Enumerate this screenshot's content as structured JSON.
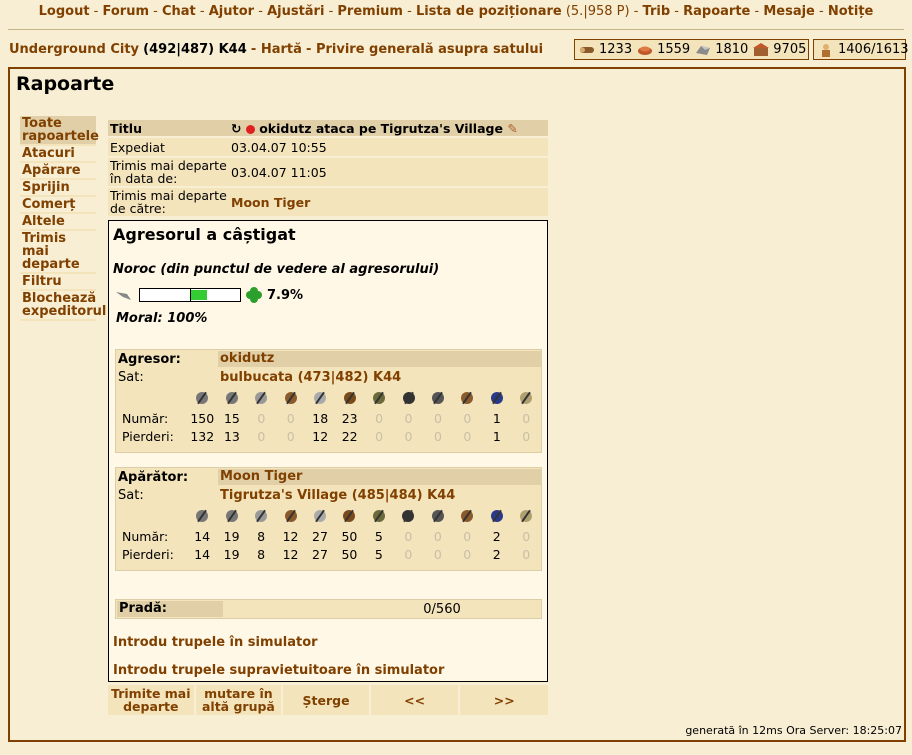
{
  "topmenu": {
    "items": [
      "Logout",
      "Forum",
      "Chat",
      "Ajutor",
      "Ajustări",
      "Premium",
      "Lista de poziționare",
      "Trib",
      "Rapoarte",
      "Mesaje",
      "Notițe"
    ],
    "ranking_info": "(5.|958 P)"
  },
  "village": {
    "name": "Underground City",
    "coords": "(492|487) K44",
    "map_link": "Hartă",
    "overview_link": "Privire generală asupra satului"
  },
  "resources": {
    "wood": "1233",
    "clay": "1559",
    "iron": "1810",
    "storage": "9705",
    "population": "1406/1613"
  },
  "page_title": "Rapoarte",
  "sidemenu": [
    "Toate rapoartele",
    "Atacuri",
    "Apărare",
    "Sprijin",
    "Comerț",
    "Altele",
    "Trimis mai departe",
    "Filtru",
    "Blochează expeditorul"
  ],
  "report": {
    "title_label": "Titlu",
    "title": "okidutz ataca pe Tigrutza's Village",
    "sent_label": "Expediat",
    "sent": "03.04.07 10:55",
    "fwd_date_label": "Trimis mai departe în data de:",
    "fwd_date": "03.04.07 11:05",
    "fwd_by_label": "Trimis mai departe de către:",
    "fwd_by": "Moon Tiger",
    "result": "Agresorul a câștigat",
    "luck_label": "Noroc (din punctul de vedere al agresorului)",
    "luck_value": "7.9%",
    "luck_fraction": 0.079,
    "morale": "Moral: 100%",
    "attacker": {
      "label": "Agresor:",
      "player": "okidutz",
      "village_label": "Sat:",
      "village": "bulbucata (473|482) K44",
      "count_label": "Număr:",
      "loss_label": "Pierderi:",
      "counts": [
        "150",
        "15",
        "0",
        "0",
        "18",
        "23",
        "0",
        "0",
        "0",
        "0",
        "1",
        "0"
      ],
      "losses": [
        "132",
        "13",
        "0",
        "0",
        "12",
        "22",
        "0",
        "0",
        "0",
        "0",
        "1",
        "0"
      ]
    },
    "defender": {
      "label": "Apărător:",
      "player": "Moon Tiger",
      "village_label": "Sat:",
      "village": "Tigrutza's Village (485|484) K44",
      "count_label": "Număr:",
      "loss_label": "Pierderi:",
      "counts": [
        "14",
        "19",
        "8",
        "12",
        "27",
        "50",
        "5",
        "0",
        "0",
        "0",
        "2",
        "0"
      ],
      "losses": [
        "14",
        "19",
        "8",
        "12",
        "27",
        "50",
        "5",
        "0",
        "0",
        "0",
        "2",
        "0"
      ]
    },
    "unit_icons": [
      "spear-icon",
      "sword-icon",
      "axe-icon",
      "archer-icon",
      "scout-icon",
      "light-cavalry-icon",
      "mounted-archer-icon",
      "heavy-cavalry-icon",
      "ram-icon",
      "catapult-icon",
      "paladin-icon",
      "noble-icon"
    ],
    "loot_label": "Pradă:",
    "loot": "0/560",
    "sim_link": "Introdu trupele în simulator",
    "sim_survivors_link": "Introdu trupele supravietuitoare în simulator"
  },
  "actions": {
    "forward": "Trimite mai departe",
    "move": "mutare în altă grupă",
    "delete": "Șterge",
    "prev": "<<",
    "next": ">>"
  },
  "footer": "generată în 12ms Ora Server: 18:25:07",
  "colors": {
    "background": "#f7eed3",
    "link": "#804000",
    "panel": "#f4e4bc",
    "header": "#e1cfa8"
  }
}
